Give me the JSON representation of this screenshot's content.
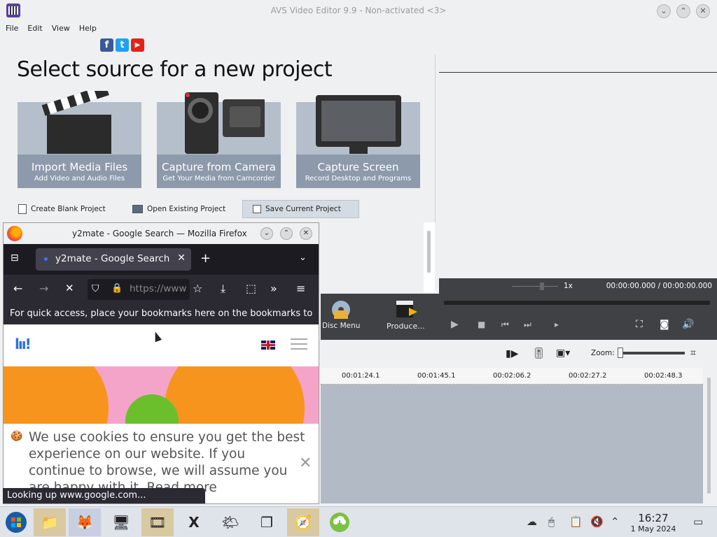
{
  "avs": {
    "title": "AVS Video Editor 9.9 - Non-activated <3>",
    "menu": [
      "File",
      "Edit",
      "View",
      "Help"
    ],
    "social": [
      "f",
      "t",
      "▶"
    ],
    "welcome_title": "Select source for a new project",
    "cards": [
      {
        "title": "Import Media Files",
        "subtitle": "Add Video and Audio Files"
      },
      {
        "title": "Capture from Camera",
        "subtitle": "Get Your Media from Camcorder"
      },
      {
        "title": "Capture Screen",
        "subtitle": "Record Desktop and Programs"
      }
    ],
    "project_actions": [
      "Create Blank Project",
      "Open Existing Project",
      "Save Current Project"
    ],
    "player": {
      "rate": "1x",
      "time": "00:00:00.000 / 00:00:00.000"
    },
    "toolbar": {
      "disc_menu": "Disc Menu",
      "produce": "Produce..."
    },
    "zoom_label": "Zoom:",
    "ruler": [
      "00:01:24.1",
      "00:01:45.1",
      "00:02:06.2",
      "00:02:27.2",
      "00:02:48.3"
    ]
  },
  "firefox": {
    "title": "y2mate - Google Search — Mozilla Firefox",
    "tab_label": "y2mate - Google Search",
    "url_text": "https://www",
    "bookmarks_text": "For quick access, place your bookmarks here on the bookmarks to",
    "cookie_text": "We use cookies to ensure you get the best experience on our website. If you continue to browse, we will assume you are happy with it. Read more",
    "status": "Looking up www.google.com..."
  },
  "taskbar": {
    "time": "16:27",
    "date": "1 May 2024"
  },
  "colors": {
    "avs_card": "#b5bfcb",
    "avs_dark": "#3f4145",
    "ff_dark": "#1c1b22",
    "timeline": "#b1bac5"
  }
}
